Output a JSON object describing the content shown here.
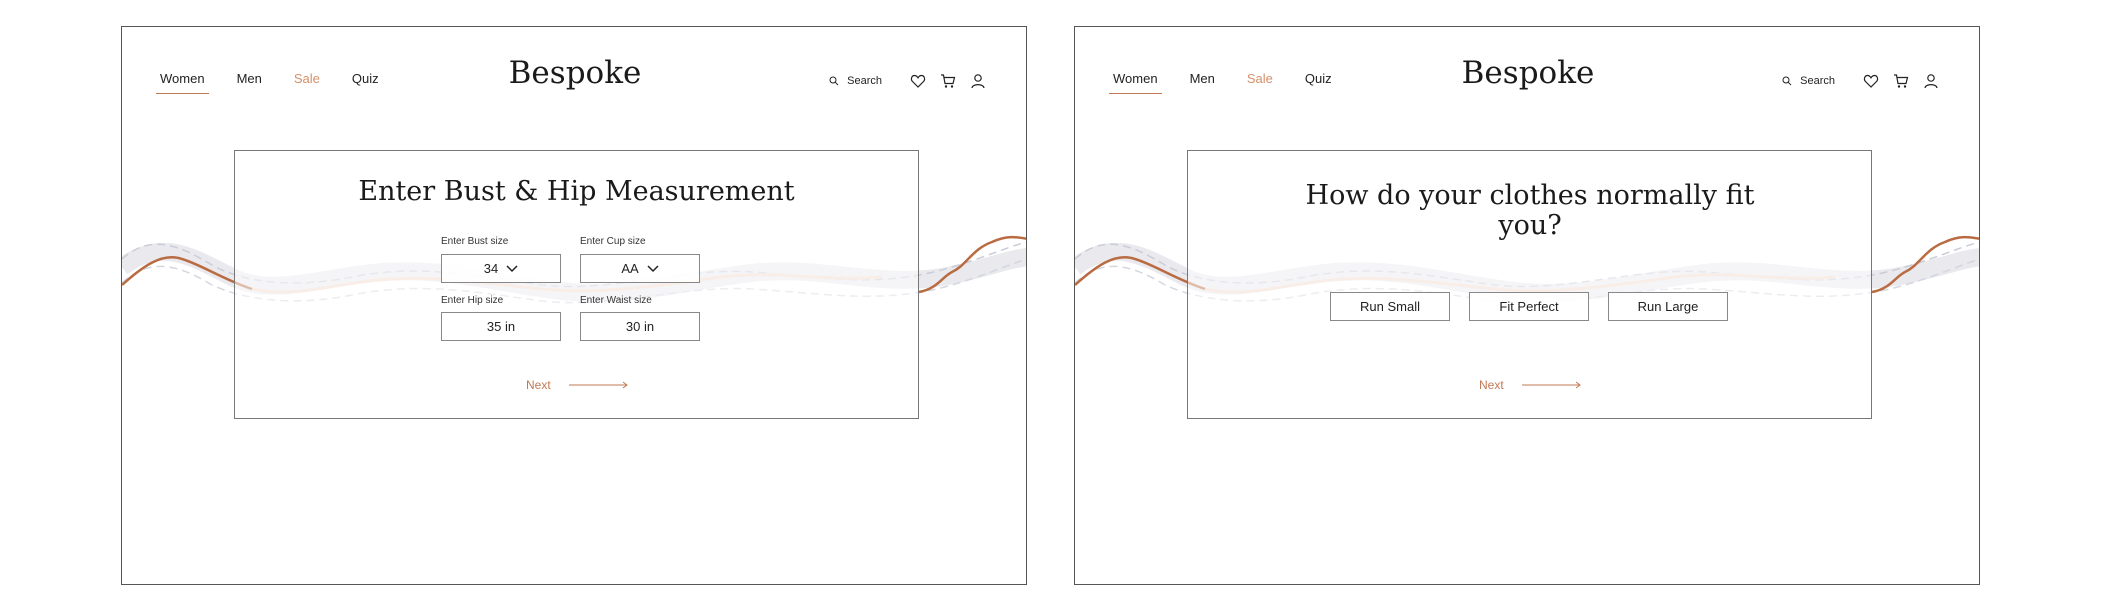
{
  "colors": {
    "accent": "#c07a55",
    "sale": "#d4906a",
    "border": "#777777"
  },
  "screens": [
    {
      "nav": {
        "women": "Women",
        "men": "Men",
        "sale": "Sale",
        "quiz": "Quiz"
      },
      "logo": "Bespoke",
      "search_label": "Search",
      "icons": [
        "search-icon",
        "heart-icon",
        "cart-icon",
        "user-icon"
      ],
      "title": "Enter Bust & Hip Measurement",
      "fields": {
        "bust": {
          "label": "Enter Bust size",
          "value": "34"
        },
        "cup": {
          "label": "Enter Cup size",
          "value": "AA"
        },
        "hip": {
          "label": "Enter Hip size",
          "value": "35 in"
        },
        "waist": {
          "label": "Enter Waist size",
          "value": "30 in"
        }
      },
      "next_label": "Next"
    },
    {
      "nav": {
        "women": "Women",
        "men": "Men",
        "sale": "Sale",
        "quiz": "Quiz"
      },
      "logo": "Bespoke",
      "search_label": "Search",
      "icons": [
        "search-icon",
        "heart-icon",
        "cart-icon",
        "user-icon"
      ],
      "title": "How do your clothes normally fit you?",
      "options": [
        "Run Small",
        "Fit Perfect",
        "Run Large"
      ],
      "next_label": "Next"
    }
  ]
}
